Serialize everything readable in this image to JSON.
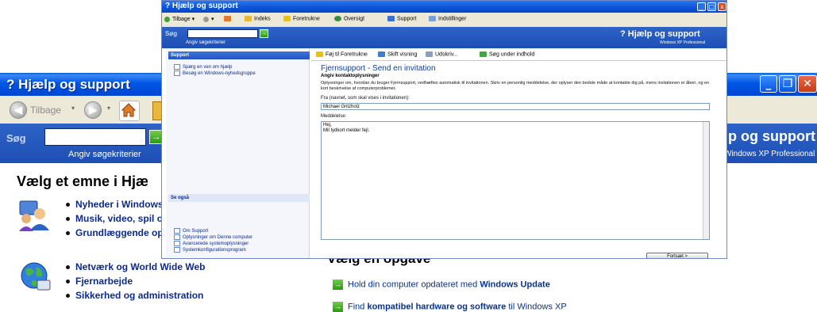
{
  "back_window": {
    "title": "Hjælp og support",
    "toolbar": {
      "back_label": "Tilbage"
    },
    "search": {
      "label": "Søg",
      "hint": "Angiv søgekriterier",
      "brand_title": "p og support",
      "brand_sub": "Windows XP Professional"
    },
    "topics_heading": "Vælg et emne i Hjæ",
    "group1": [
      "Nyheder i Windows",
      "Musik, video, spil og",
      "Grundlæggende opl"
    ],
    "group2": [
      "Netværk og World Wide Web",
      "Fjernarbejde",
      "Sikkerhed og administration"
    ],
    "tasks_heading": "Vælg en opgave",
    "tasks": [
      {
        "prefix": "Hold din computer opdateret med ",
        "bold": "Windows Update",
        "suffix": ""
      },
      {
        "prefix": "Find ",
        "bold": "kompatibel hardware og software",
        "suffix": " til Windows XP"
      }
    ]
  },
  "front_window": {
    "title": "Hjælp og support",
    "toolbar": {
      "back": "Tilbage",
      "index": "Indeks",
      "favorites": "Foretrukne",
      "history": "Oversigt",
      "support": "Support",
      "options": "Indstillinger"
    },
    "search": {
      "label": "Søg",
      "hint": "Angiv søgekriterier",
      "brand_title": "Hjælp og support",
      "brand_sub": "Windows XP Professional"
    },
    "support_panel": {
      "heading": "Support",
      "items": [
        "Spørg en ven om hjælp",
        "Besøg en Windows-nyhedsgruppe"
      ]
    },
    "see_also_panel": {
      "heading": "Se også",
      "items": [
        "Om Support",
        "Oplysninger om Denne computer",
        "Avancerede systemoplysninger",
        "Systemkonfigurationsprogram"
      ]
    },
    "main_toolbar": {
      "add_fav": "Føj til Foretrukne",
      "change_view": "Skift visning",
      "print": "Udskriv...",
      "find_in_page": "Søg under indhold"
    },
    "invite": {
      "title": "Fjernsupport - Send en invitation",
      "subtitle": "Angiv kontaktoplysninger",
      "description": "Oplysninger om, hvordan du bruger Fjernsupport, vedhæftes automatisk til invitationen. Skriv en personlig meddelelse, der oplyser den bedste måde at kontakte dig på, mens invitationen er åben, og en kort beskrivelse af computerproblemet.",
      "from_label": "Fra (navnet, som skal vises i invitationen):",
      "from_value": "Michael Gritzholz",
      "message_label": "Meddelelse:",
      "message_line1": "Hej,",
      "message_line2": "Mit lydkort melder fejl.",
      "continue_button": "Fortsæt >"
    }
  },
  "colors": {
    "xp_title": "#0055e5",
    "search_band": "#2558c0",
    "link_blue": "#0b2a8f",
    "go_green": "#2c9a12"
  }
}
